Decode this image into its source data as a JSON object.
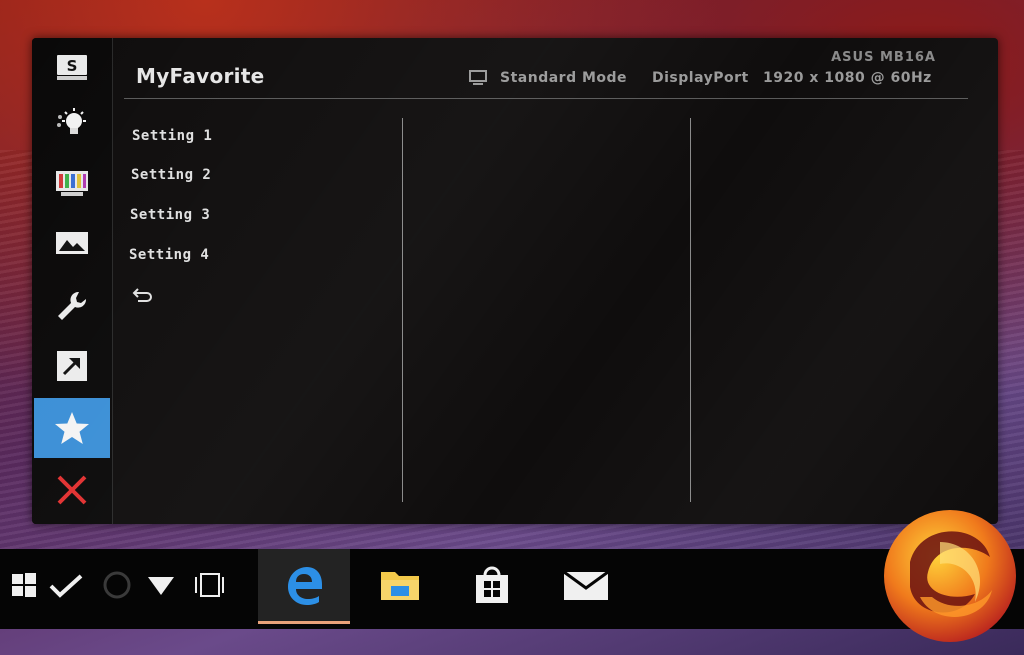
{
  "osd": {
    "title": "MyFavorite",
    "model": "ASUS MB16A",
    "mode": "Standard Mode",
    "input": "DisplayPort",
    "resolution": "1920 x 1080 @ 60Hz",
    "accent_color": "#3b8fd6",
    "menu_items": [
      "Setting 1",
      "Setting 2",
      "Setting 3",
      "Setting 4"
    ],
    "sidebar": [
      {
        "icon": "splendid-s-icon"
      },
      {
        "icon": "blue-light-filter-icon"
      },
      {
        "icon": "color-bars-icon"
      },
      {
        "icon": "image-icon"
      },
      {
        "icon": "wrench-icon"
      },
      {
        "icon": "shortcut-arrow-icon"
      },
      {
        "icon": "star-icon",
        "active": true
      },
      {
        "icon": "close-icon"
      }
    ]
  },
  "taskbar": {
    "apps": [
      "edge-icon",
      "file-explorer-icon",
      "store-icon",
      "mail-icon"
    ],
    "active_app": "edge-icon"
  }
}
